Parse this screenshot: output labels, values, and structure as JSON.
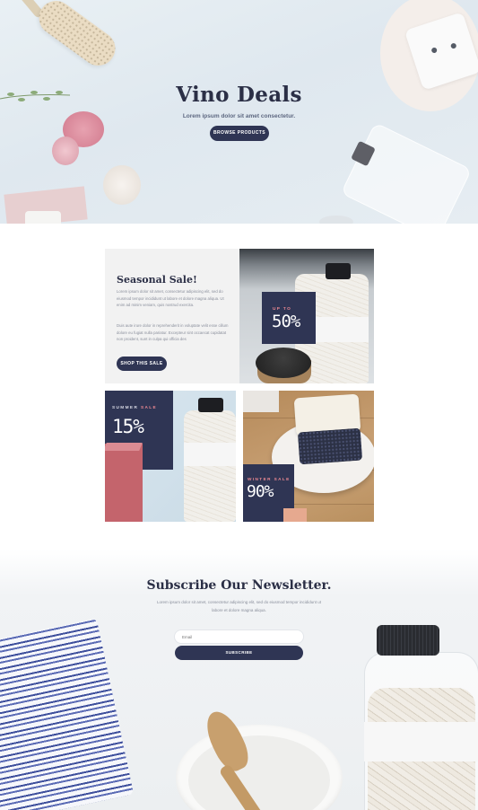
{
  "hero": {
    "title": "Vino Deals",
    "subtitle": "Lorem ipsum dolor sit amet consectetur.",
    "button_label": "BROWSE PRODUCTS"
  },
  "sale": {
    "seasonal": {
      "title": "Seasonal Sale!",
      "paragraph_1": "Lorem ipsum dolor sit amet, consectetur adipiscing elit, sed do eiusmod tempor incididunt ut labore et dolore magna aliqua. Ut enim ad minim veniam, quis nostrud exercita.",
      "paragraph_2": "Duis aute irure dolor in reprehenderit in voluptate velit esse cillum dolore eu fugiat nulla pariatur. Excepteur sint occaecat cupidatat non proident, sunt in culpa qui officia des",
      "button_label": "SHOP THIS SALE"
    },
    "promo_1": {
      "label_accent": "UP TO",
      "value": "50%"
    },
    "promo_2": {
      "label_plain": "SUMMER",
      "label_accent": "SALE",
      "value": "15%"
    },
    "promo_3": {
      "label_accent": "WINTER SALE",
      "value": "90%"
    }
  },
  "newsletter": {
    "title": "Subscribe Our Newsletter.",
    "subtitle": "Lorem ipsum dolor sit amet, consectetur adipiscing elit, sed do eiusmod tempor incididunt ut labore et dolore magna aliqua.",
    "email_placeholder": "Email",
    "button_label": "SUBSCRIBE"
  },
  "colors": {
    "navy": "#2f3554",
    "accent_pink": "#ef8a93",
    "light_panel": "#f2f2f2"
  },
  "icons": [
    "brush-image",
    "soap-dish-image",
    "sea-urchin-image",
    "bottle-image",
    "towel-image",
    "bowl-image"
  ]
}
